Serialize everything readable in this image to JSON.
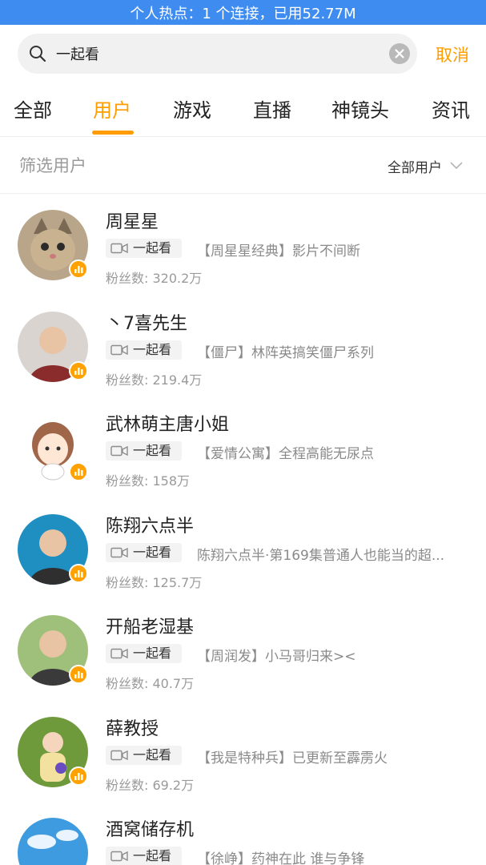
{
  "status_bar": {
    "hotspot_text": "个人热点：1 个连接，已用52.77M"
  },
  "search": {
    "query": "一起看",
    "cancel_label": "取消"
  },
  "tabs": [
    {
      "label": "全部",
      "active": false
    },
    {
      "label": "用户",
      "active": true
    },
    {
      "label": "游戏",
      "active": false
    },
    {
      "label": "直播",
      "active": false
    },
    {
      "label": "神镜头",
      "active": false
    },
    {
      "label": "资讯",
      "active": false
    }
  ],
  "filter": {
    "label": "筛选用户",
    "selected": "全部用户"
  },
  "users": [
    {
      "name": "周星星",
      "tag": "一起看",
      "latest": "【周星星经典】影片不间断",
      "fans": "粉丝数: 320.2万",
      "avatar_icon": "cat-avatar",
      "avatar_colors": [
        "#b8a58a",
        "#7a6a55"
      ]
    },
    {
      "name": "丶7喜先生",
      "tag": "一起看",
      "latest": "【僵尸】林阵英搞笑僵尸系列",
      "fans": "粉丝数: 219.4万",
      "avatar_icon": "person-avatar",
      "avatar_colors": [
        "#d9d4d0",
        "#8a2c2c"
      ]
    },
    {
      "name": "武林萌主唐小姐",
      "tag": "一起看",
      "latest": "【爱情公寓】全程高能无尿点",
      "fans": "粉丝数: 158万",
      "avatar_icon": "cartoon-girl-avatar",
      "avatar_colors": [
        "#ffffff",
        "#a0664a"
      ]
    },
    {
      "name": "陈翔六点半",
      "tag": "一起看",
      "latest": "陈翔六点半·第169集普通人也能当的超...",
      "fans": "粉丝数: 125.7万",
      "avatar_icon": "person-avatar",
      "avatar_colors": [
        "#1f8fc2",
        "#2f2f2f"
      ]
    },
    {
      "name": "开船老湿基",
      "tag": "一起看",
      "latest": "【周润发】小马哥归来><",
      "fans": "粉丝数: 40.7万",
      "avatar_icon": "person-avatar",
      "avatar_colors": [
        "#9fc07a",
        "#3a3a3a"
      ]
    },
    {
      "name": "薛教授",
      "tag": "一起看",
      "latest": "【我是特种兵】已更新至霹雳火",
      "fans": "粉丝数: 69.2万",
      "avatar_icon": "child-avatar",
      "avatar_colors": [
        "#6f9a3c",
        "#f3e1a0"
      ]
    },
    {
      "name": "酒窝储存机",
      "tag": "一起看",
      "latest": "【徐峥】药神在此 谁与争锋",
      "fans": "",
      "avatar_icon": "sky-avatar",
      "avatar_colors": [
        "#3f9be0",
        "#eaf4ff"
      ]
    }
  ],
  "colors": {
    "accent": "#ff9c00",
    "status_bar": "#3f8cf0",
    "live_badge": "#ffa100"
  },
  "icons": {
    "search": "search-icon",
    "clear": "clear-icon",
    "filter": "chevron-down-icon",
    "tag": "camera-icon",
    "badge": "live-bars-icon"
  }
}
